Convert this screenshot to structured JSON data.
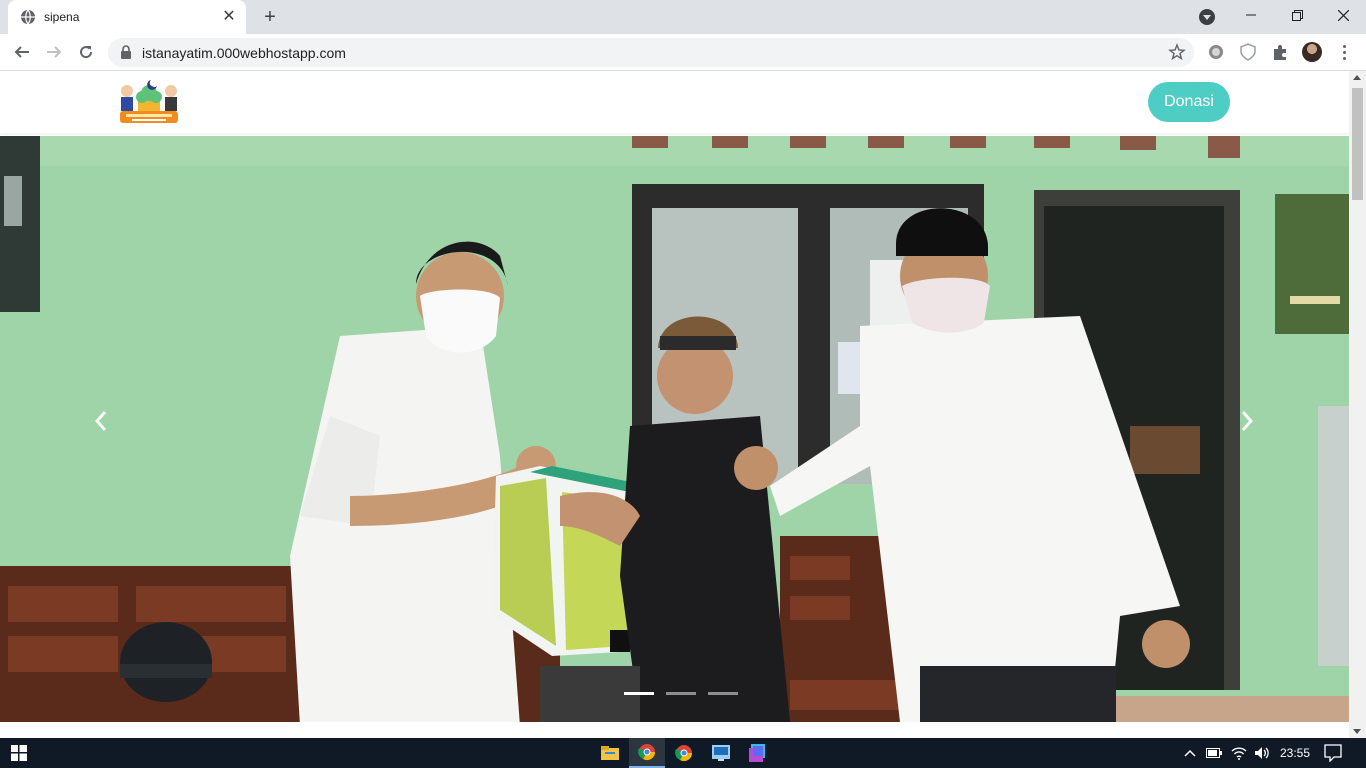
{
  "browser": {
    "tab": {
      "title": "sipena",
      "favicon": "globe-icon"
    },
    "url": "istanayatim.000webhostapp.com",
    "window_controls": [
      "minimize",
      "maximize",
      "close"
    ]
  },
  "site": {
    "logo_text": "Istana Yatim",
    "donate_button": "Donasi",
    "carousel": {
      "slide_count": 3,
      "active_index": 0,
      "prev_icon": "chevron-left-icon",
      "next_icon": "chevron-right-icon"
    }
  },
  "taskbar": {
    "apps": [
      "file-explorer-icon",
      "chrome-icon",
      "chrome-icon",
      "app-icon",
      "app-icon"
    ],
    "time": "23:55"
  },
  "colors": {
    "accent": "#4ecdc4",
    "wall": "#9fd4a8",
    "taskbar": "#101a26"
  }
}
